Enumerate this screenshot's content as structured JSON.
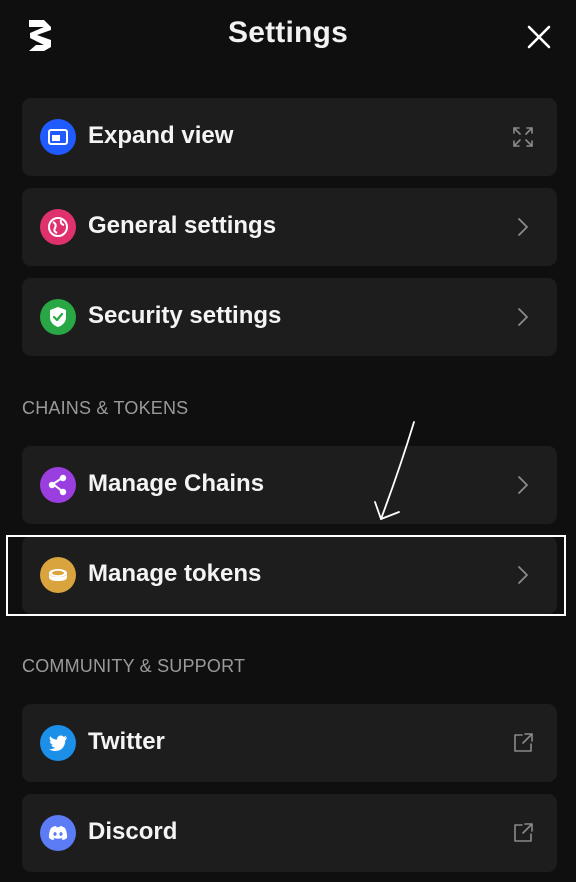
{
  "header": {
    "title": "Settings",
    "logo_icon": "brand-logo-icon",
    "close_icon": "close-icon"
  },
  "main_items": [
    {
      "label": "Expand view",
      "icon": "expand-view-icon",
      "icon_color": "#1f5bff",
      "trailing": "expand-arrows-icon"
    },
    {
      "label": "General settings",
      "icon": "globe-icon",
      "icon_color": "#e0316f",
      "trailing": "chevron-right-icon"
    },
    {
      "label": "Security settings",
      "icon": "shield-check-icon",
      "icon_color": "#29a745",
      "trailing": "chevron-right-icon"
    }
  ],
  "sections": {
    "chains_tokens": {
      "title": "CHAINS & TOKENS",
      "items": [
        {
          "label": "Manage Chains",
          "icon": "share-nodes-icon",
          "icon_color": "#9b3ee0",
          "trailing": "chevron-right-icon"
        },
        {
          "label": "Manage tokens",
          "icon": "coin-icon",
          "icon_color": "#d9a43e",
          "trailing": "chevron-right-icon"
        }
      ]
    },
    "community_support": {
      "title": "COMMUNITY & SUPPORT",
      "items": [
        {
          "label": "Twitter",
          "icon": "twitter-bird-icon",
          "icon_color": "#1c8fe8",
          "trailing": "external-link-icon"
        },
        {
          "label": "Discord",
          "icon": "discord-icon",
          "icon_color": "#5b7cf5",
          "trailing": "external-link-icon"
        }
      ]
    }
  },
  "annotation": {
    "highlighted_item": "Manage tokens",
    "pointer": "hand-drawn-arrow-icon"
  }
}
